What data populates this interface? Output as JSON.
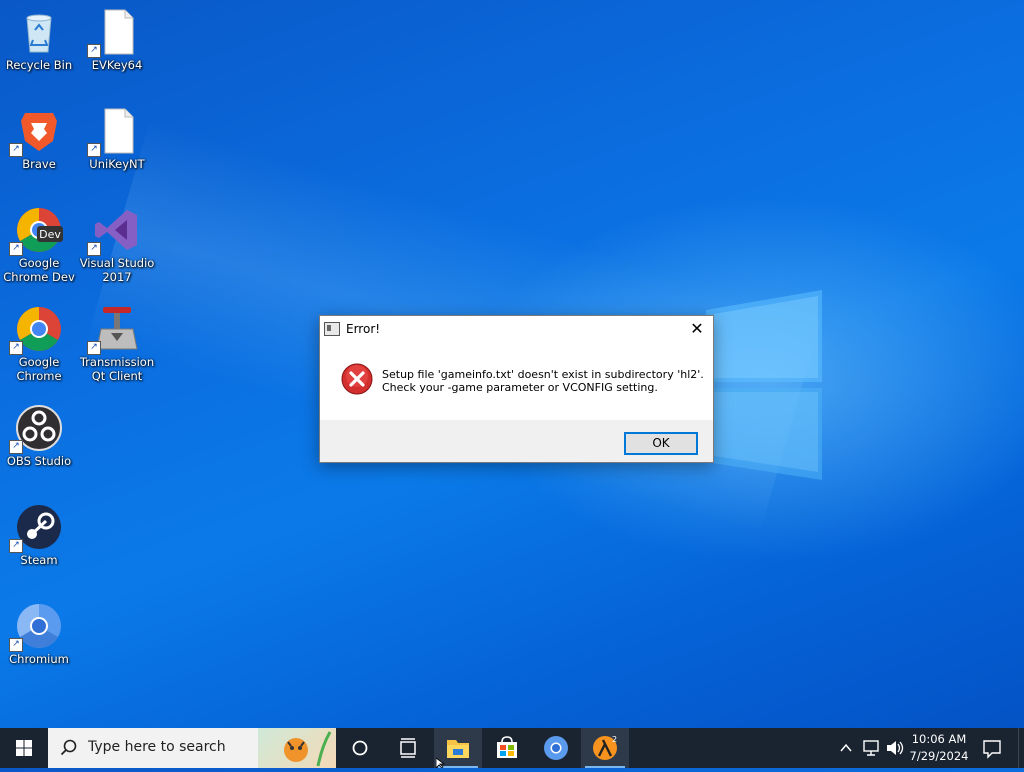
{
  "desktop": {
    "icons": [
      {
        "label": "Recycle Bin"
      },
      {
        "label": "EVKey64"
      },
      {
        "label": "Brave"
      },
      {
        "label": "UniKeyNT"
      },
      {
        "label": "Google\nChrome Dev"
      },
      {
        "label": "Visual Studio\n2017"
      },
      {
        "label": "Google\nChrome"
      },
      {
        "label": "Transmission\nQt Client"
      },
      {
        "label": "OBS Studio"
      },
      {
        "label": "Steam"
      },
      {
        "label": "Chromium"
      }
    ]
  },
  "dialog": {
    "title": "Error!",
    "close_glyph": "✕",
    "message_line1": "Setup file 'gameinfo.txt' doesn't exist in subdirectory 'hl2'.",
    "message_line2": "Check your -game parameter or VCONFIG setting.",
    "ok_label": "OK"
  },
  "taskbar": {
    "search_placeholder": "Type here to search",
    "time": "10:06 AM",
    "date": "7/29/2024"
  },
  "colors": {
    "accent": "#0078d7",
    "error_red": "#d32f2f"
  }
}
